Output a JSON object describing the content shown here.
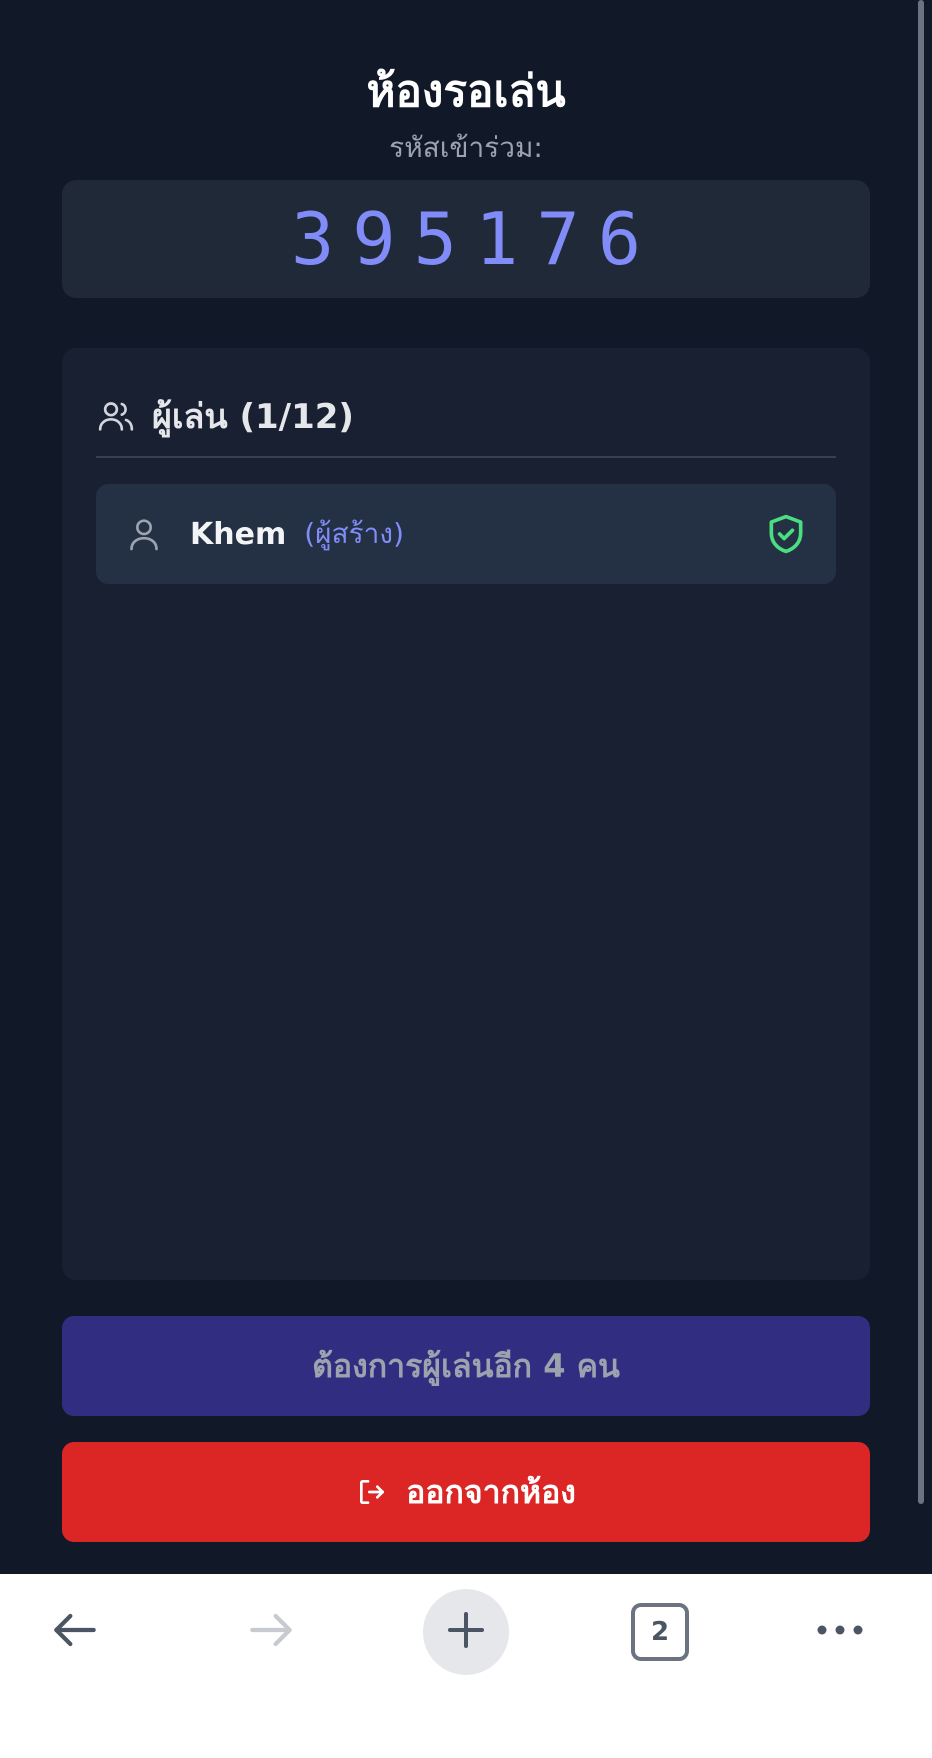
{
  "room": {
    "title": "ห้องรอเล่น",
    "join_code_label": "รหัสเข้าร่วม:",
    "join_code": "395176"
  },
  "players": {
    "header": "ผู้เล่น (1/12)",
    "list": [
      {
        "name": "Khem",
        "role": "(ผู้สร้าง)",
        "status_icon": "shield-check-icon"
      }
    ]
  },
  "buttons": {
    "need_players": "ต้องการผู้เล่นอีก 4 คน",
    "leave_room": "ออกจากห้อง"
  },
  "browser": {
    "tab_count": "2",
    "icons": [
      "back-arrow-icon",
      "forward-arrow-icon",
      "plus-icon",
      "tabs-icon",
      "more-icon"
    ]
  },
  "colors": {
    "background": "#111827",
    "accent": "#818cf8",
    "need_button": "#312e81",
    "leave_button": "#dc2626",
    "host_badge": "#4ade80"
  }
}
